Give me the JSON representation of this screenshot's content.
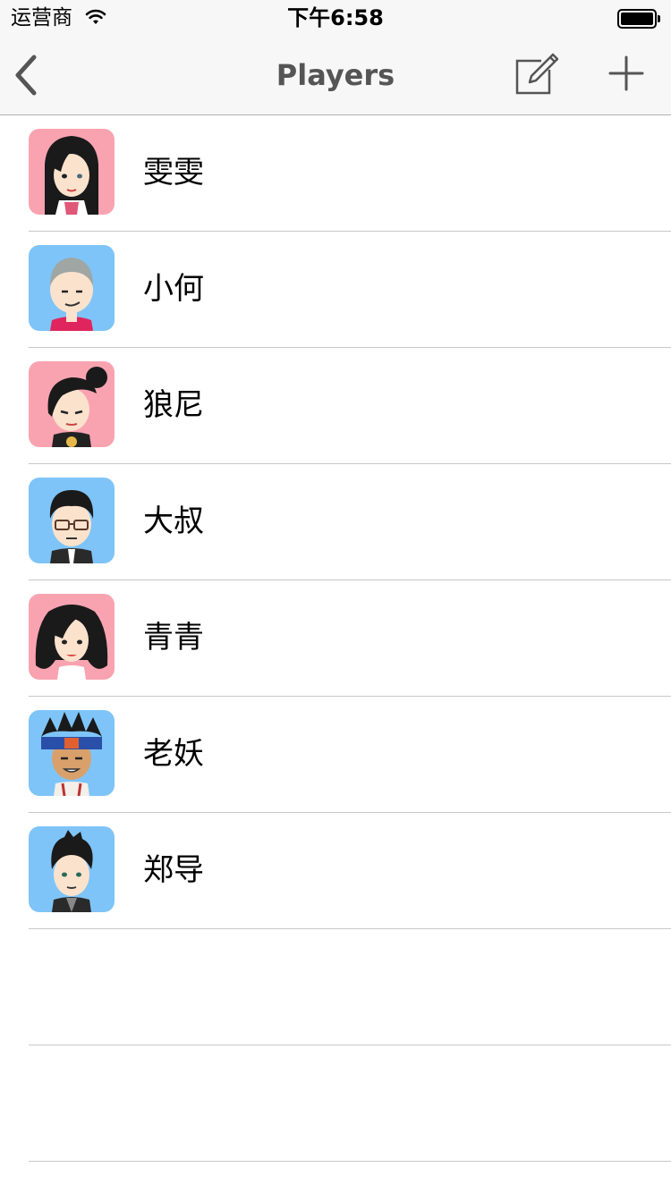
{
  "status_bar": {
    "carrier": "运营商",
    "time": "下午6:58"
  },
  "nav": {
    "title": "Players",
    "back_icon": "chevron-left-icon",
    "compose_icon": "compose-icon",
    "add_icon": "plus-icon",
    "tint": "#555555"
  },
  "players": [
    {
      "name": "雯雯",
      "avatar_bg": "#f9a3b0",
      "avatar": "female-long-hair"
    },
    {
      "name": "小何",
      "avatar_bg": "#7ec4f8",
      "avatar": "male-grey-hair"
    },
    {
      "name": "狼尼",
      "avatar_bg": "#f9a3b0",
      "avatar": "female-ponytail"
    },
    {
      "name": "大叔",
      "avatar_bg": "#7ec4f8",
      "avatar": "male-glasses"
    },
    {
      "name": "青青",
      "avatar_bg": "#f9a3b0",
      "avatar": "female-curly-hair"
    },
    {
      "name": "老妖",
      "avatar_bg": "#7ec4f8",
      "avatar": "male-headband"
    },
    {
      "name": "郑导",
      "avatar_bg": "#7ec4f8",
      "avatar": "male-spiky-hair"
    }
  ]
}
